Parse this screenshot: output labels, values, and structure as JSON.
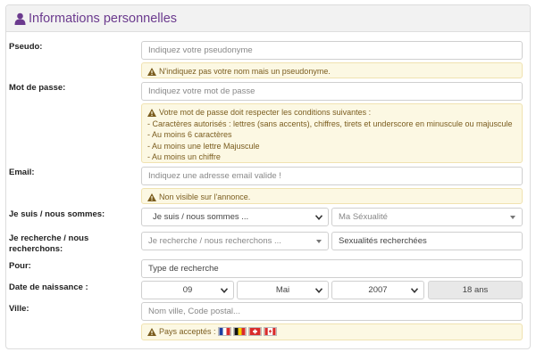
{
  "panel": {
    "title": "Informations personnelles",
    "icon": "user-icon",
    "accent": "#6b3a8e"
  },
  "pseudo": {
    "label": "Pseudo:",
    "placeholder": "Indiquez votre pseudonyme",
    "warning": "N'indiquez pas votre nom mais un pseudonyme."
  },
  "password": {
    "label": "Mot de passe:",
    "placeholder": "Indiquez votre mot de passe",
    "warning_title": "Votre mot de passe doit respecter les conditions suivantes :",
    "rules": [
      "- Caractères autorisés : lettres (sans accents), chiffres, tirets et underscore en minuscule ou majuscule",
      "- Au moins 6 caractères",
      "- Au moins une lettre Majuscule",
      "- Au moins un chiffre"
    ]
  },
  "email": {
    "label": "Email:",
    "placeholder": "Indiquez une adresse email valide !",
    "warning": "Non visible sur l'annonce."
  },
  "je_suis": {
    "label": "Je suis / nous sommes:",
    "select_value": "Je suis / nous sommes ...",
    "sexuality_value": "Ma Séxualité"
  },
  "recherche": {
    "label_line1": "Je recherche / nous",
    "label_line2": "recherchons:",
    "select_value": "Je recherche / nous recherchons ...",
    "sexualities_value": "Sexualités recherchées"
  },
  "pour": {
    "label": "Pour:",
    "placeholder": "Type de recherche"
  },
  "naissance": {
    "label": "Date de naissance :",
    "day": "09",
    "month": "Mai",
    "year": "2007",
    "age": "18 ans"
  },
  "ville": {
    "label": "Ville:",
    "placeholder": "Nom ville, Code postal...",
    "warning": "Pays acceptés :",
    "flags": [
      "France",
      "Belgique",
      "Suisse",
      "Canada"
    ]
  },
  "colors": {
    "warning_bg": "#fcf8e3",
    "warning_text": "#7a5c1e",
    "readonly_bg": "#e8e8e8"
  }
}
